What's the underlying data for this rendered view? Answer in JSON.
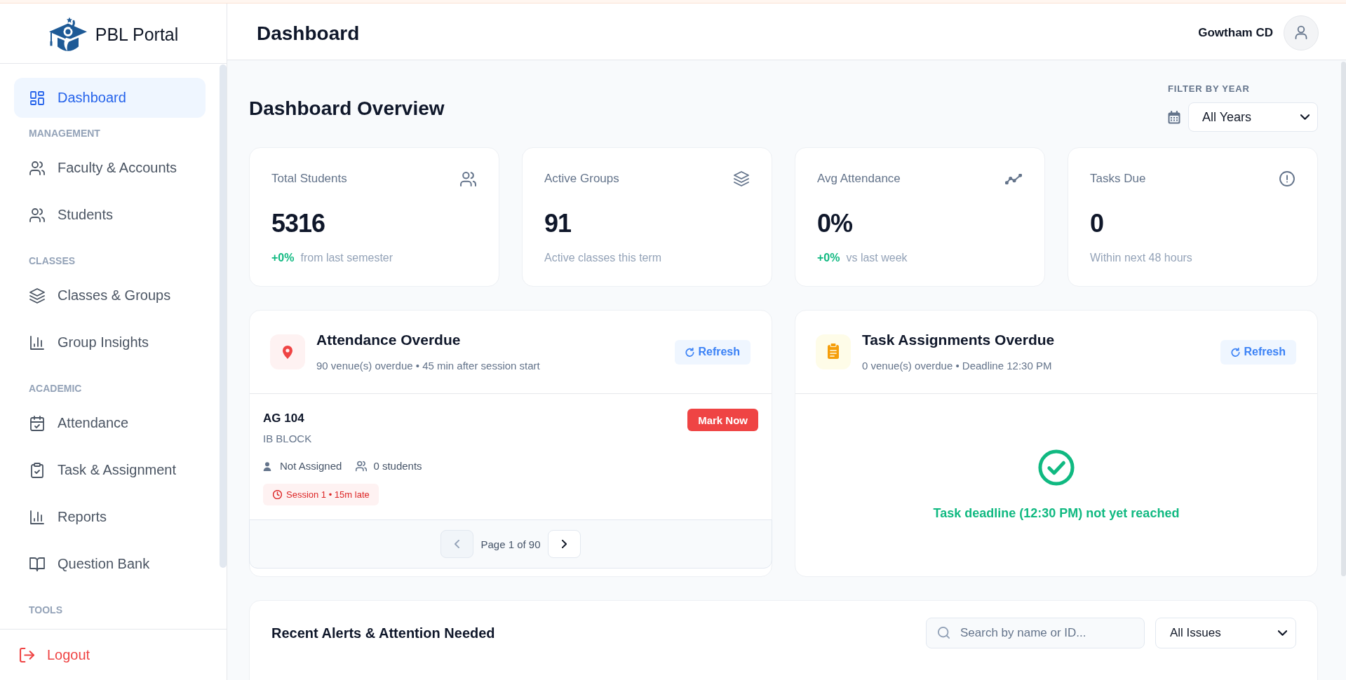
{
  "sidebar": {
    "brand": "PBL Portal",
    "sections": [
      {
        "items": [
          {
            "label": "Dashboard",
            "selected": true
          }
        ]
      },
      {
        "heading": "MANAGEMENT",
        "items": [
          {
            "label": "Faculty & Accounts",
            "selected": false
          },
          {
            "label": "Students",
            "selected": false
          }
        ]
      },
      {
        "heading": "CLASSES",
        "items": [
          {
            "label": "Classes & Groups",
            "selected": false
          },
          {
            "label": "Group Insights",
            "selected": false
          }
        ]
      },
      {
        "heading": "ACADEMIC",
        "items": [
          {
            "label": "Attendance",
            "selected": false
          },
          {
            "label": "Task & Assignment",
            "selected": false
          },
          {
            "label": "Reports",
            "selected": false
          },
          {
            "label": "Question Bank",
            "selected": false
          }
        ]
      },
      {
        "heading": "TOOLS"
      }
    ],
    "logout": "Logout"
  },
  "header": {
    "title": "Dashboard",
    "user_name": "Gowtham CD"
  },
  "overview": {
    "title": "Dashboard Overview",
    "filter_label": "FILTER BY YEAR",
    "year": "All Years"
  },
  "stats": [
    {
      "title": "Total Students",
      "value": "5316",
      "trend": "+0%",
      "note": "from last semester"
    },
    {
      "title": "Active Groups",
      "value": "91",
      "note": "Active classes this term"
    },
    {
      "title": "Avg Attendance",
      "value": "0%",
      "trend": "+0%",
      "note": "vs last week"
    },
    {
      "title": "Tasks Due",
      "value": "0",
      "note": "Within next 48 hours"
    }
  ],
  "attendance_overdue": {
    "title": "Attendance Overdue",
    "subtitle": "90 venue(s) overdue • 45 min after session start",
    "refresh": "Refresh",
    "venues": [
      {
        "name": "AG 104",
        "block": "IB BLOCK",
        "action": "Mark Now",
        "faculty": "Not Assigned",
        "students": "0 students",
        "late": "Session 1 • 15m late"
      }
    ],
    "pagination": {
      "label": "Page 1 of 90",
      "prev": {
        "disabled": true
      },
      "next": {
        "disabled": false
      }
    }
  },
  "task_overdue": {
    "title": "Task Assignments Overdue",
    "subtitle": "0 venue(s) overdue • Deadline 12:30 PM",
    "refresh": "Refresh",
    "message": "Task deadline (12:30 PM) not yet reached"
  },
  "alerts": {
    "title": "Recent Alerts & Attention Needed",
    "search": {
      "placeholder": "Search by name or ID..."
    },
    "issue_filter": "All Issues"
  }
}
